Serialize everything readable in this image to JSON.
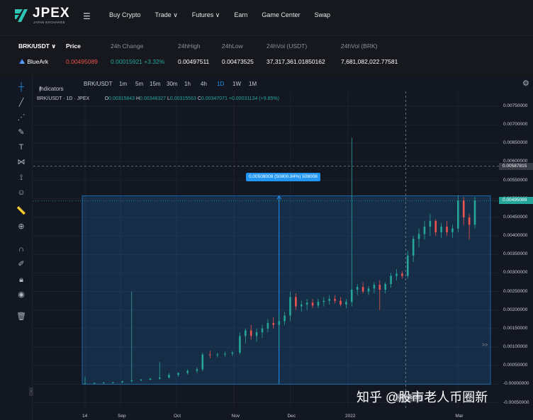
{
  "brand": {
    "name": "JPEX",
    "sub": "JAPAN EXCHANGE",
    "color": "#2ec4b6"
  },
  "nav": {
    "menu_icon": "hamburger-icon",
    "items": [
      "Buy Crypto",
      "Trade ∨",
      "Futures ∨",
      "Earn",
      "Game Center",
      "Swap"
    ]
  },
  "ticker": {
    "pair": "BRK/USDT",
    "headers": {
      "price": "Price",
      "change": "24h Change",
      "high": "24hHigh",
      "low": "24hLow",
      "vol_usdt": "24hVol (USDT)",
      "vol_brk": "24hVol (BRK)"
    },
    "coin": "BlueArk",
    "price": "0.00495089",
    "change": "0.00015921 +3.32%",
    "high": "0.00497511",
    "low": "0.00473525",
    "vol_usdt": "37,317,361.01850162",
    "vol_brk": "7,681,082,022.77581"
  },
  "chart_toolbar": {
    "indicators": "Indicators",
    "symbol": "BRK/USDT",
    "intervals": [
      "1m",
      "5m",
      "15m",
      "30m",
      "1h",
      "4h",
      "1D",
      "1W",
      "1M"
    ],
    "active_interval": "1D"
  },
  "legend": {
    "symbol": "BRK/USDT · 1D · JPEX",
    "o_label": "O",
    "o": "0.00315843",
    "h_label": "H",
    "h": "0.00348327",
    "l_label": "L",
    "l": "0.00315563",
    "c_label": "C",
    "c": "0.00347071",
    "chg": "+0.00031134 (+9.85%)"
  },
  "measure_label": "0.00508008 (50800.84%) 508008",
  "crosshair_price": "0.00587815",
  "last_price_tag": "0.00495089",
  "crosshair_date": "04 Feb '22",
  "expand": ">>",
  "watermark": "知乎 @股市老人币圈新",
  "colors": {
    "up": "#26a69a",
    "down": "#ef5350",
    "measure": "#2196f3",
    "bg": "#131722"
  },
  "chart_data": {
    "type": "candlestick",
    "title": "BRK/USDT · 1D · JPEX",
    "y_ticks": [
      "0.00750000",
      "0.00700000",
      "0.00650000",
      "0.00600000",
      "0.00550000",
      "0.00500000",
      "0.00450000",
      "0.00400000",
      "0.00350000",
      "0.00300000",
      "0.00250000",
      "0.00200000",
      "0.00150000",
      "0.00100000",
      "0.00050000",
      "-0.00000000",
      "-0.00050000"
    ],
    "ylim": [
      -0.0007,
      0.0079
    ],
    "x_ticks": [
      "14",
      "Sep",
      "Oct",
      "Nov",
      "Dec",
      "2022",
      "Mar"
    ],
    "x_tick_days": [
      0,
      19,
      49,
      80,
      110,
      141,
      200
    ],
    "range_start_price": 0.0,
    "range_end_price": 0.00508008,
    "candles": [
      {
        "d": 0,
        "o": 1e-05,
        "h": 0.0002,
        "l": 0.0,
        "c": 2e-05
      },
      {
        "d": 5,
        "o": 2e-05,
        "h": 5e-05,
        "l": 1e-05,
        "c": 3e-05
      },
      {
        "d": 10,
        "o": 3e-05,
        "h": 6e-05,
        "l": 2e-05,
        "c": 4e-05
      },
      {
        "d": 15,
        "o": 4e-05,
        "h": 6e-05,
        "l": 2e-05,
        "c": 5e-05
      },
      {
        "d": 20,
        "o": 5e-05,
        "h": 8e-05,
        "l": 3e-05,
        "c": 8e-05
      },
      {
        "d": 25,
        "o": 8e-05,
        "h": 0.0025,
        "l": 5e-05,
        "c": 0.0001
      },
      {
        "d": 30,
        "o": 0.0001,
        "h": 0.00014,
        "l": 8e-05,
        "c": 0.00012
      },
      {
        "d": 35,
        "o": 0.00012,
        "h": 0.00016,
        "l": 0.0001,
        "c": 0.00015
      },
      {
        "d": 40,
        "o": 0.00015,
        "h": 0.0006,
        "l": 0.00012,
        "c": 0.00018
      },
      {
        "d": 45,
        "o": 0.00018,
        "h": 0.0003,
        "l": 0.00015,
        "c": 0.00025
      },
      {
        "d": 50,
        "o": 0.00025,
        "h": 0.00032,
        "l": 0.0002,
        "c": 0.0003
      },
      {
        "d": 55,
        "o": 0.0003,
        "h": 0.0004,
        "l": 0.00026,
        "c": 0.00036
      },
      {
        "d": 60,
        "o": 0.00036,
        "h": 0.00045,
        "l": 0.0003,
        "c": 0.0004
      },
      {
        "d": 63,
        "o": 0.0004,
        "h": 0.00085,
        "l": 0.00035,
        "c": 0.0008
      },
      {
        "d": 67,
        "o": 0.0008,
        "h": 0.0009,
        "l": 0.0007,
        "c": 0.00078
      },
      {
        "d": 71,
        "o": 0.00078,
        "h": 0.00085,
        "l": 0.00072,
        "c": 0.0008
      },
      {
        "d": 75,
        "o": 0.0008,
        "h": 0.00088,
        "l": 0.00074,
        "c": 0.00082
      },
      {
        "d": 79,
        "o": 0.00082,
        "h": 0.0009,
        "l": 0.00076,
        "c": 0.00085
      },
      {
        "d": 83,
        "o": 0.00085,
        "h": 0.0014,
        "l": 0.0008,
        "c": 0.0013
      },
      {
        "d": 86,
        "o": 0.0013,
        "h": 0.0015,
        "l": 0.0011,
        "c": 0.00145
      },
      {
        "d": 89,
        "o": 0.00145,
        "h": 0.0016,
        "l": 0.0012,
        "c": 0.0013
      },
      {
        "d": 92,
        "o": 0.0013,
        "h": 0.0015,
        "l": 0.00115,
        "c": 0.0014
      },
      {
        "d": 95,
        "o": 0.0014,
        "h": 0.0016,
        "l": 0.00125,
        "c": 0.0015
      },
      {
        "d": 98,
        "o": 0.0015,
        "h": 0.00175,
        "l": 0.0014,
        "c": 0.00165
      },
      {
        "d": 101,
        "o": 0.00165,
        "h": 0.0018,
        "l": 0.0015,
        "c": 0.0016
      },
      {
        "d": 104,
        "o": 0.0016,
        "h": 0.0019,
        "l": 0.001,
        "c": 0.0017
      },
      {
        "d": 107,
        "o": 0.0017,
        "h": 0.00195,
        "l": 0.0016,
        "c": 0.00185
      },
      {
        "d": 110,
        "o": 0.00185,
        "h": 0.0025,
        "l": 0.0017,
        "c": 0.00235
      },
      {
        "d": 113,
        "o": 0.00235,
        "h": 0.00245,
        "l": 0.002,
        "c": 0.0021
      },
      {
        "d": 116,
        "o": 0.0021,
        "h": 0.00225,
        "l": 0.00195,
        "c": 0.00215
      },
      {
        "d": 119,
        "o": 0.00215,
        "h": 0.0023,
        "l": 0.002,
        "c": 0.0022
      },
      {
        "d": 122,
        "o": 0.0022,
        "h": 0.0023,
        "l": 0.00205,
        "c": 0.00212
      },
      {
        "d": 125,
        "o": 0.00212,
        "h": 0.0023,
        "l": 0.00205,
        "c": 0.00222
      },
      {
        "d": 128,
        "o": 0.00222,
        "h": 0.00235,
        "l": 0.0021,
        "c": 0.00225
      },
      {
        "d": 131,
        "o": 0.00225,
        "h": 0.0024,
        "l": 0.00215,
        "c": 0.0023
      },
      {
        "d": 134,
        "o": 0.0023,
        "h": 0.0024,
        "l": 0.00218,
        "c": 0.00225
      },
      {
        "d": 137,
        "o": 0.00225,
        "h": 0.00235,
        "l": 0.0021,
        "c": 0.00215
      },
      {
        "d": 140,
        "o": 0.00215,
        "h": 0.0023,
        "l": 0.00205,
        "c": 0.00222
      },
      {
        "d": 143,
        "o": 0.00222,
        "h": 0.00665,
        "l": 0.0021,
        "c": 0.00255
      },
      {
        "d": 146,
        "o": 0.00255,
        "h": 0.0027,
        "l": 0.0024,
        "c": 0.00262
      },
      {
        "d": 149,
        "o": 0.00262,
        "h": 0.00275,
        "l": 0.00245,
        "c": 0.0025
      },
      {
        "d": 152,
        "o": 0.0025,
        "h": 0.00265,
        "l": 0.0024,
        "c": 0.00258
      },
      {
        "d": 155,
        "o": 0.00258,
        "h": 0.00275,
        "l": 0.00245,
        "c": 0.00268
      },
      {
        "d": 158,
        "o": 0.00268,
        "h": 0.0028,
        "l": 0.002,
        "c": 0.00255
      },
      {
        "d": 161,
        "o": 0.00255,
        "h": 0.00275,
        "l": 0.00245,
        "c": 0.0027
      },
      {
        "d": 164,
        "o": 0.0027,
        "h": 0.003,
        "l": 0.0026,
        "c": 0.00292
      },
      {
        "d": 167,
        "o": 0.00292,
        "h": 0.0031,
        "l": 0.0028,
        "c": 0.00298
      },
      {
        "d": 170,
        "o": 0.00298,
        "h": 0.00305,
        "l": 0.00285,
        "c": 0.00292
      },
      {
        "d": 173,
        "o": 0.00292,
        "h": 0.0036,
        "l": 0.00285,
        "c": 0.00347
      },
      {
        "d": 176,
        "o": 0.00347,
        "h": 0.004,
        "l": 0.0033,
        "c": 0.00392
      },
      {
        "d": 179,
        "o": 0.00392,
        "h": 0.0042,
        "l": 0.0037,
        "c": 0.00405
      },
      {
        "d": 182,
        "o": 0.00405,
        "h": 0.0044,
        "l": 0.0039,
        "c": 0.00425
      },
      {
        "d": 185,
        "o": 0.00425,
        "h": 0.0046,
        "l": 0.004,
        "c": 0.0044
      },
      {
        "d": 188,
        "o": 0.0044,
        "h": 0.00445,
        "l": 0.004,
        "c": 0.0041
      },
      {
        "d": 191,
        "o": 0.0041,
        "h": 0.00435,
        "l": 0.00395,
        "c": 0.00425
      },
      {
        "d": 194,
        "o": 0.00425,
        "h": 0.0044,
        "l": 0.004,
        "c": 0.0041
      },
      {
        "d": 197,
        "o": 0.0041,
        "h": 0.0043,
        "l": 0.00395,
        "c": 0.0042
      },
      {
        "d": 200,
        "o": 0.0042,
        "h": 0.0051,
        "l": 0.0041,
        "c": 0.00495
      },
      {
        "d": 203,
        "o": 0.00495,
        "h": 0.00505,
        "l": 0.0043,
        "c": 0.0045
      },
      {
        "d": 206,
        "o": 0.0045,
        "h": 0.0046,
        "l": 0.0039,
        "c": 0.0043
      },
      {
        "d": 209,
        "o": 0.0043,
        "h": 0.00505,
        "l": 0.0042,
        "c": 0.00495
      }
    ]
  }
}
